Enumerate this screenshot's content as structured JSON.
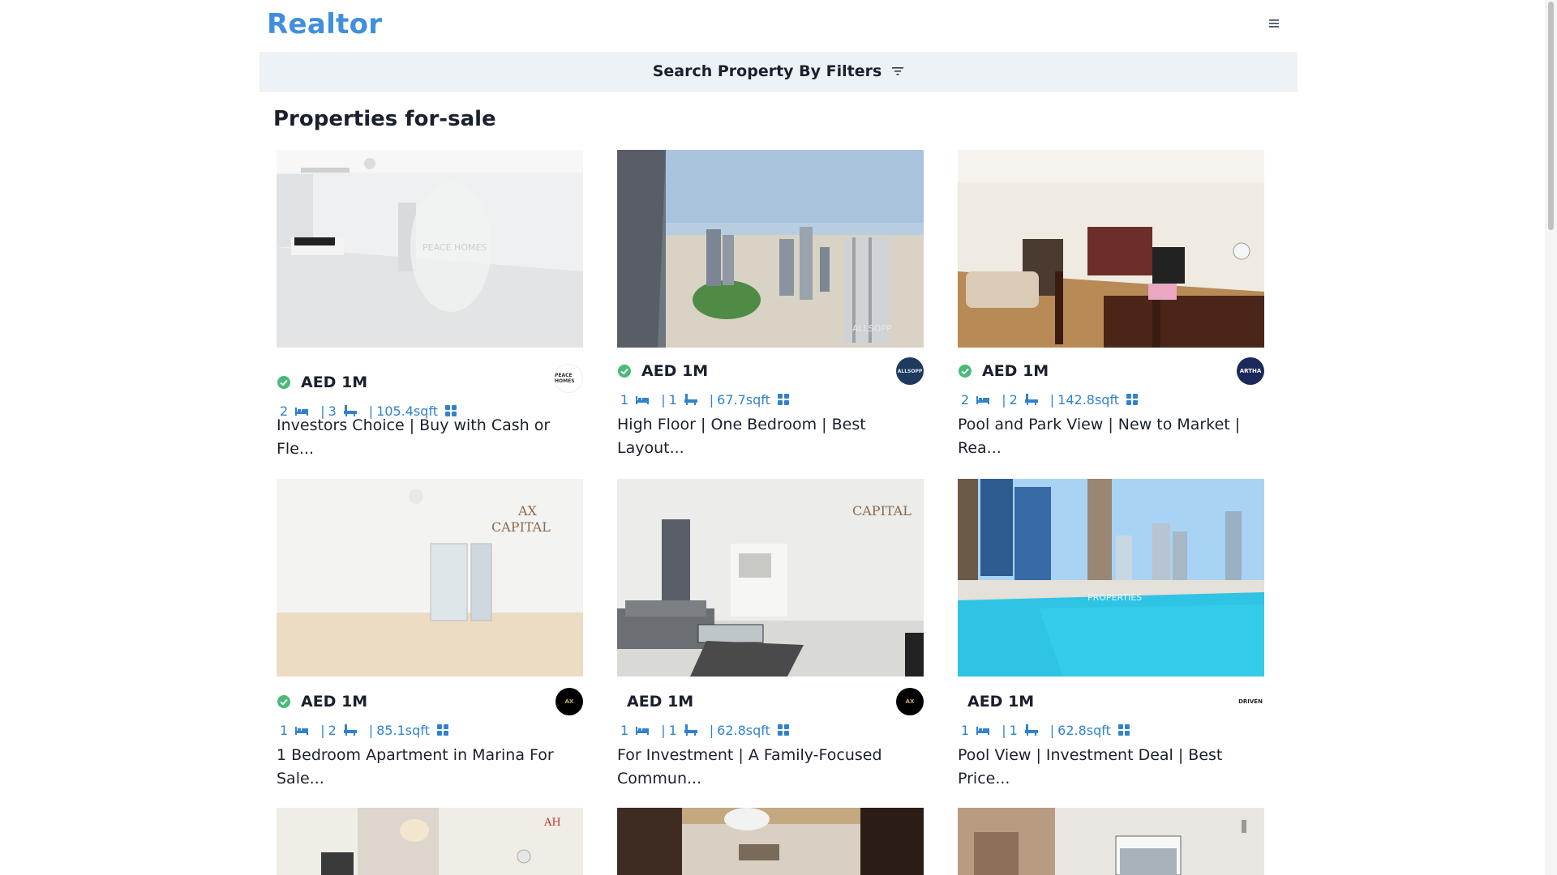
{
  "app": {
    "logo": "Realtor"
  },
  "filter_bar": {
    "label": "Search Property By Filters"
  },
  "heading": "Properties for-sale",
  "colors": {
    "accent": "#3182ce",
    "logo": "#3f8fdd",
    "verified": "#48bb78",
    "filter_bg": "#edf2f7"
  },
  "properties": [
    {
      "price": "AED 1M",
      "verified": true,
      "rooms": "2",
      "baths": "3",
      "area": "105.4sqft",
      "title": "Investors Choice | Buy with Cash or Fle...",
      "agency": "PEACE HOMES",
      "photo": "white-empty-living-room",
      "watermark": "PEACE HOMES"
    },
    {
      "price": "AED 1M",
      "verified": true,
      "rooms": "1",
      "baths": "1",
      "area": "67.7sqft",
      "title": "High Floor | One Bedroom | Best Layout...",
      "agency": "ALLSOPP",
      "photo": "city-skyline-from-balcony",
      "watermark": "ALLSOPP"
    },
    {
      "price": "AED 1M",
      "verified": true,
      "rooms": "2",
      "baths": "2",
      "area": "142.8sqft",
      "title": "Pool and Park View | New to Market | Rea...",
      "agency": "ARTHA",
      "photo": "furnished-living-dining",
      "watermark": ""
    },
    {
      "price": "AED 1M",
      "verified": true,
      "rooms": "1",
      "baths": "2",
      "area": "85.1sqft",
      "title": "1 Bedroom Apartment in Marina For Sale...",
      "agency": "AX",
      "photo": "bedroom-white-tiles",
      "watermark": "CAPITAL"
    },
    {
      "price": "AED 1M",
      "verified": false,
      "rooms": "1",
      "baths": "1",
      "area": "62.8sqft",
      "title": "For Investment | A Family-Focused Commun...",
      "agency": "AX",
      "photo": "living-room-sofa",
      "watermark": "CAPITAL"
    },
    {
      "price": "AED 1M",
      "verified": false,
      "rooms": "1",
      "baths": "1",
      "area": "62.8sqft",
      "title": "Pool View | Investment Deal | Best Price...",
      "agency": "DRIVEN",
      "photo": "pool-view",
      "watermark": "PROPERTIES"
    },
    {
      "photo": "hallway-lamp",
      "watermark": "AH"
    },
    {
      "photo": "lobby-chandelier",
      "watermark": ""
    },
    {
      "photo": "kitchen-window",
      "watermark": ""
    }
  ]
}
